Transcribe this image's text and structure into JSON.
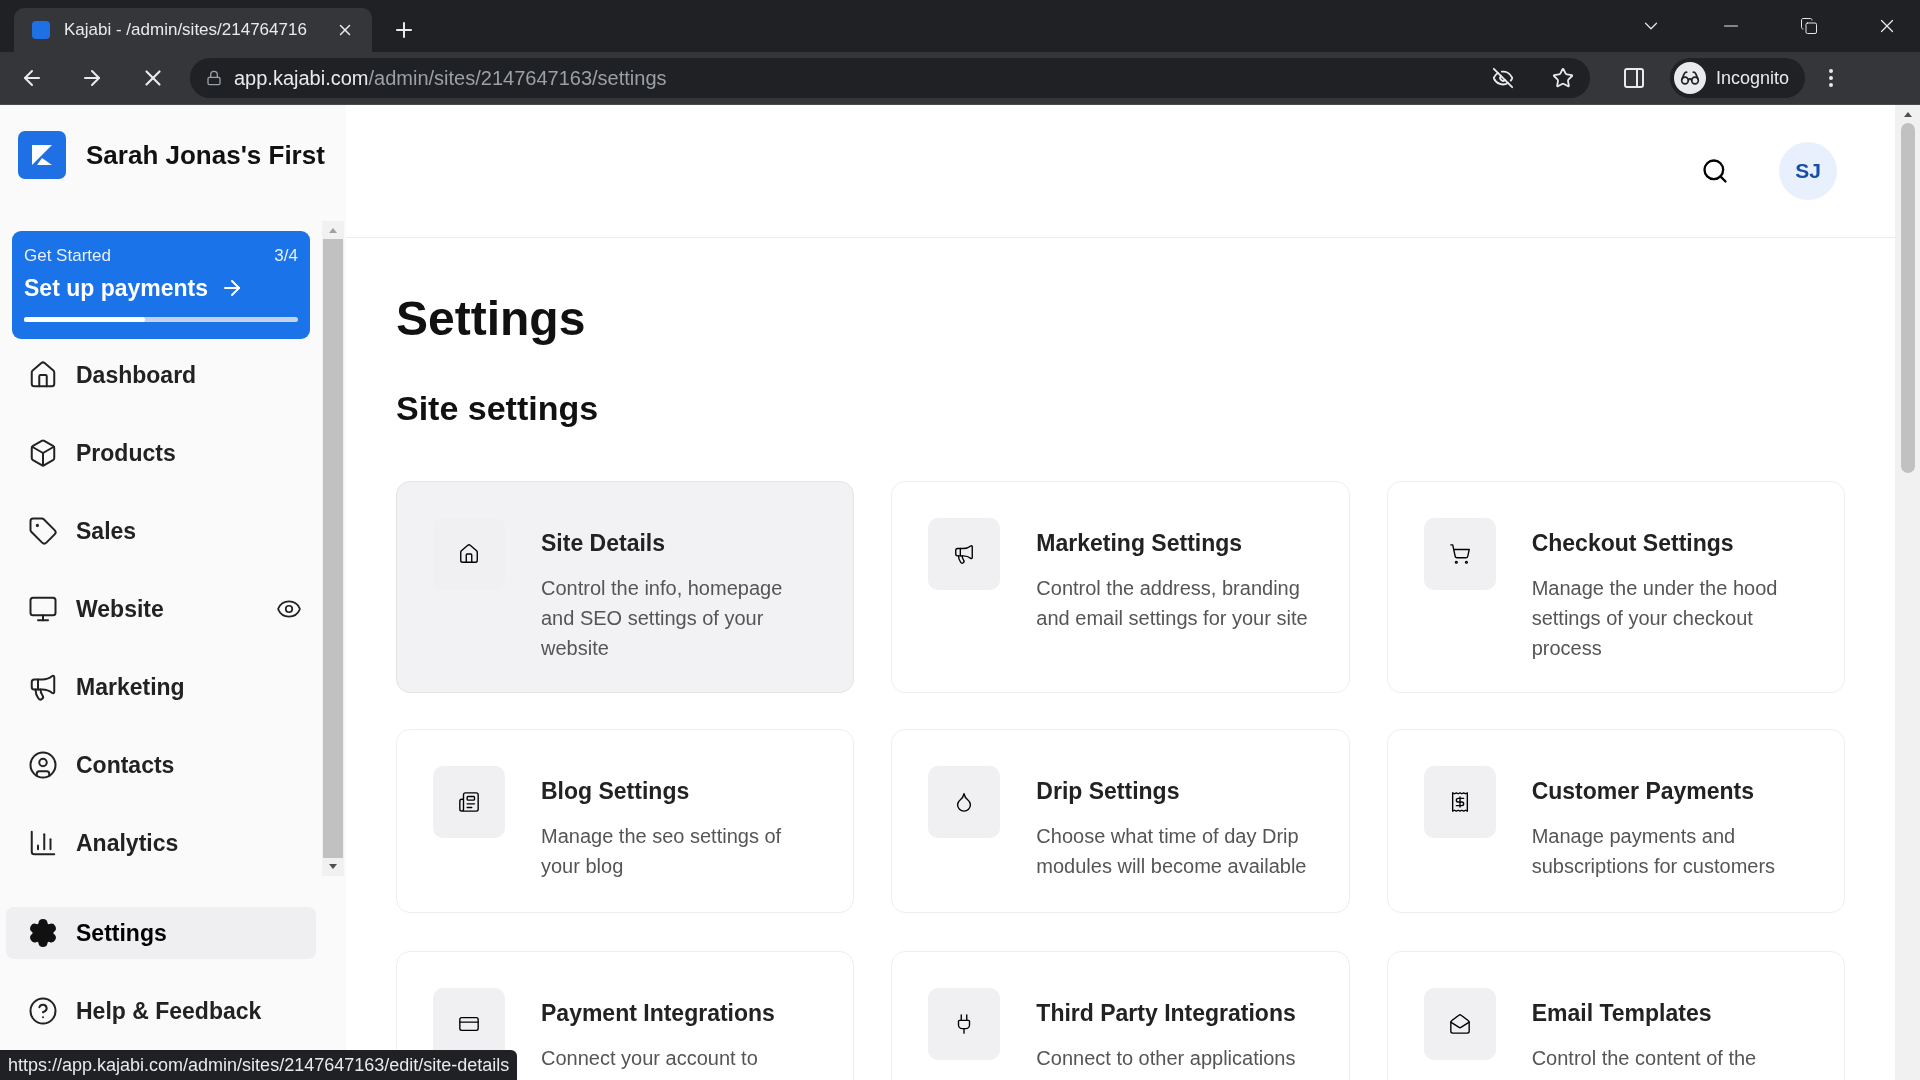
{
  "browser": {
    "tab_title": "Kajabi - /admin/sites/214764716",
    "url_host": "app.kajabi.com",
    "url_path": "/admin/sites/2147647163/settings",
    "profile": "Incognito"
  },
  "sidebar": {
    "site_name": "Sarah Jonas's First",
    "get_started": {
      "label": "Get Started",
      "count": "3/4",
      "action": "Set up payments",
      "level": 0.44
    },
    "items": [
      {
        "label": "Dashboard",
        "selected": false
      },
      {
        "label": "Products",
        "selected": false
      },
      {
        "label": "Sales",
        "selected": false
      },
      {
        "label": "Website",
        "selected": false
      },
      {
        "label": "Marketing",
        "selected": false
      },
      {
        "label": "Contacts",
        "selected": false
      },
      {
        "label": "Analytics",
        "selected": false
      }
    ],
    "bottom_items": [
      {
        "label": "Settings",
        "selected": true
      },
      {
        "label": "Help & Feedback",
        "selected": false
      }
    ]
  },
  "header": {
    "avatar": "SJ"
  },
  "page_title": "Settings",
  "section_title": "Site settings",
  "cards": [
    {
      "title": "Site Details",
      "description": "Control the info, homepage and SEO settings of your website",
      "hovered": true
    },
    {
      "title": "Marketing Settings",
      "description": "Control the address, branding and email settings for your site",
      "hovered": false
    },
    {
      "title": "Checkout Settings",
      "description": "Manage the under the hood settings of your checkout process",
      "hovered": false
    },
    {
      "title": "Blog Settings",
      "description": "Manage the seo settings of your blog",
      "hovered": false
    },
    {
      "title": "Drip Settings",
      "description": "Choose what time of day Drip modules will become available",
      "hovered": false
    },
    {
      "title": "Customer Payments",
      "description": "Manage payments and subscriptions for customers",
      "hovered": false
    },
    {
      "title": "Payment Integrations",
      "description": "Connect your account to",
      "hovered": false
    },
    {
      "title": "Third Party Integrations",
      "description": "Connect to other applications",
      "hovered": false
    },
    {
      "title": "Email Templates",
      "description": "Control the content of the",
      "hovered": false
    }
  ],
  "status_link": "https://app.kajabi.com/admin/sites/2147647163/edit/site-details"
}
